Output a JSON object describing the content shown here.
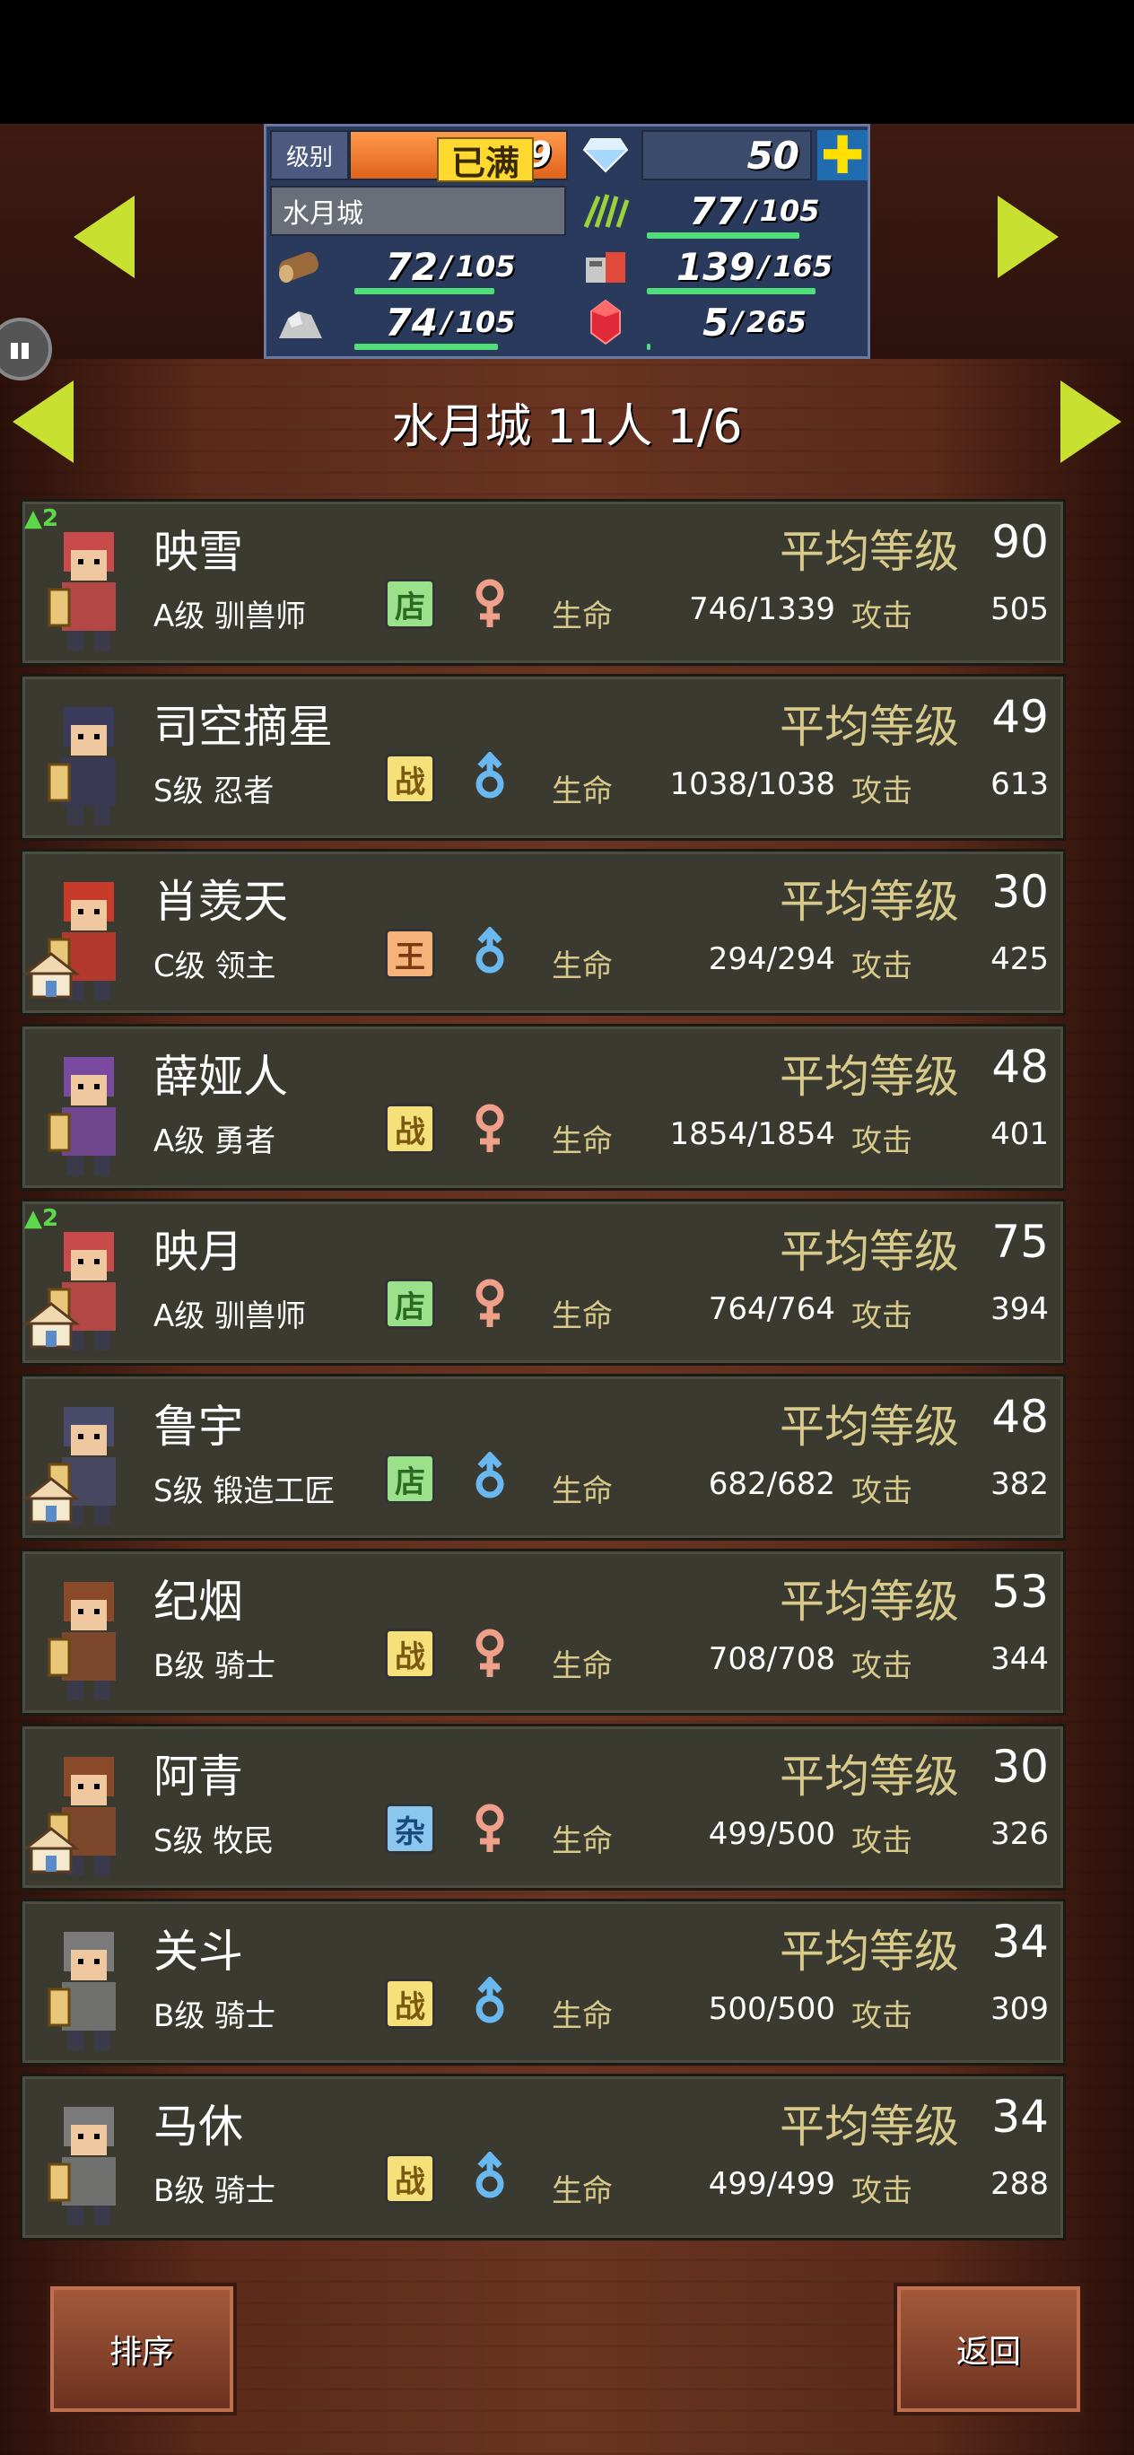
{
  "resources": {
    "level_label": "级别",
    "level_max": "已满",
    "level": "9",
    "gems": "50",
    "plus": "✚",
    "city": "水月城",
    "food": {
      "cur": "77",
      "max": "105"
    },
    "wood": {
      "cur": "72",
      "max": "105"
    },
    "popgoods": {
      "cur": "139",
      "max": "165"
    },
    "ore": {
      "cur": "74",
      "max": "105"
    },
    "ruby": {
      "cur": "5",
      "max": "265"
    }
  },
  "title": "水月城  11人 1/6",
  "labels": {
    "avg_level": "平均等级",
    "hp": "生命",
    "attack": "攻击"
  },
  "residents": [
    {
      "name": "映雪",
      "cls": "A级 驯兽师",
      "tag": "店",
      "tag_type": "shop",
      "gender": "female",
      "avg": "90",
      "hp": "746/1339",
      "atk": "505",
      "badge": "2",
      "house": false
    },
    {
      "name": "司空摘星",
      "cls": "S级 忍者",
      "tag": "战",
      "tag_type": "war",
      "gender": "male",
      "avg": "49",
      "hp": "1038/1038",
      "atk": "613",
      "badge": "",
      "house": false
    },
    {
      "name": "肖羡天",
      "cls": "C级 领主",
      "tag": "王",
      "tag_type": "king",
      "gender": "male",
      "avg": "30",
      "hp": "294/294",
      "atk": "425",
      "badge": "",
      "house": true
    },
    {
      "name": "薛娅人",
      "cls": "A级 勇者",
      "tag": "战",
      "tag_type": "war",
      "gender": "female",
      "avg": "48",
      "hp": "1854/1854",
      "atk": "401",
      "badge": "",
      "house": false
    },
    {
      "name": "映月",
      "cls": "A级 驯兽师",
      "tag": "店",
      "tag_type": "shop",
      "gender": "female",
      "avg": "75",
      "hp": "764/764",
      "atk": "394",
      "badge": "2",
      "house": true
    },
    {
      "name": "鲁宇",
      "cls": "S级 锻造工匠",
      "tag": "店",
      "tag_type": "shop",
      "gender": "male",
      "avg": "48",
      "hp": "682/682",
      "atk": "382",
      "badge": "",
      "house": true
    },
    {
      "name": "纪烟",
      "cls": "B级 骑士",
      "tag": "战",
      "tag_type": "war",
      "gender": "female",
      "avg": "53",
      "hp": "708/708",
      "atk": "344",
      "badge": "",
      "house": false
    },
    {
      "name": "阿青",
      "cls": "S级 牧民",
      "tag": "杂",
      "tag_type": "misc",
      "gender": "female",
      "avg": "30",
      "hp": "499/500",
      "atk": "326",
      "badge": "",
      "house": true
    },
    {
      "name": "关斗",
      "cls": "B级 骑士",
      "tag": "战",
      "tag_type": "war",
      "gender": "male",
      "avg": "34",
      "hp": "500/500",
      "atk": "309",
      "badge": "",
      "house": false
    },
    {
      "name": "马休",
      "cls": "B级 骑士",
      "tag": "战",
      "tag_type": "war",
      "gender": "male",
      "avg": "34",
      "hp": "499/499",
      "atk": "288",
      "badge": "",
      "house": false
    }
  ],
  "buttons": {
    "sort": "排序",
    "back": "返回"
  },
  "colors": {
    "accent_green": "#4fde7a",
    "arrow_yellow": "#c8e030",
    "card_bg": "#3a3a30",
    "label_gold": "#d6c98a"
  }
}
